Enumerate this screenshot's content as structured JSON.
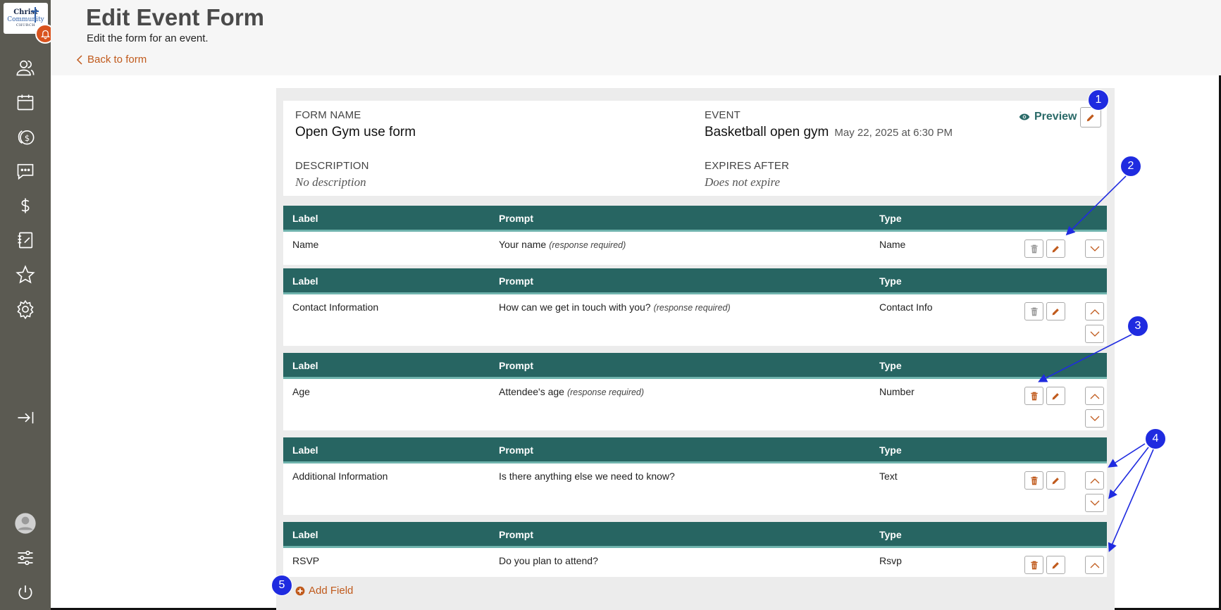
{
  "logo": {
    "line1": "Christ",
    "line2": "Community",
    "line3": "CHURCH"
  },
  "header": {
    "title": "Edit Event Form",
    "subtitle": "Edit the form for an event.",
    "back_label": "Back to form"
  },
  "form_info": {
    "form_name_label": "FORM NAME",
    "form_name": "Open Gym use form",
    "event_label": "EVENT",
    "event_name": "Basketball open gym",
    "event_date": "May 22, 2025 at 6:30 PM",
    "description_label": "DESCRIPTION",
    "description": "No description",
    "expires_label": "EXPIRES AFTER",
    "expires": "Does not expire",
    "preview_label": "Preview"
  },
  "columns": {
    "label": "Label",
    "prompt": "Prompt",
    "type": "Type"
  },
  "fields": [
    {
      "label": "Name",
      "prompt": "Your name",
      "required_note": "(response required)",
      "type": "Name"
    },
    {
      "label": "Contact Information",
      "prompt": "How can we get in touch with you?",
      "required_note": "(response required)",
      "type": "Contact Info"
    },
    {
      "label": "Age",
      "prompt": "Attendee's age",
      "required_note": "(response required)",
      "type": "Number"
    },
    {
      "label": "Additional Information",
      "prompt": "Is there anything else we need to know?",
      "required_note": "",
      "type": "Text"
    },
    {
      "label": "RSVP",
      "prompt": "Do you plan to attend?",
      "required_note": "",
      "type": "Rsvp"
    }
  ],
  "add_field_label": "Add Field",
  "callouts": [
    "1",
    "2",
    "3",
    "4",
    "5"
  ],
  "colors": {
    "accent": "#c05a1c",
    "teal": "#276562",
    "sidebar": "#5b5a52",
    "callout": "#1f2be0"
  }
}
